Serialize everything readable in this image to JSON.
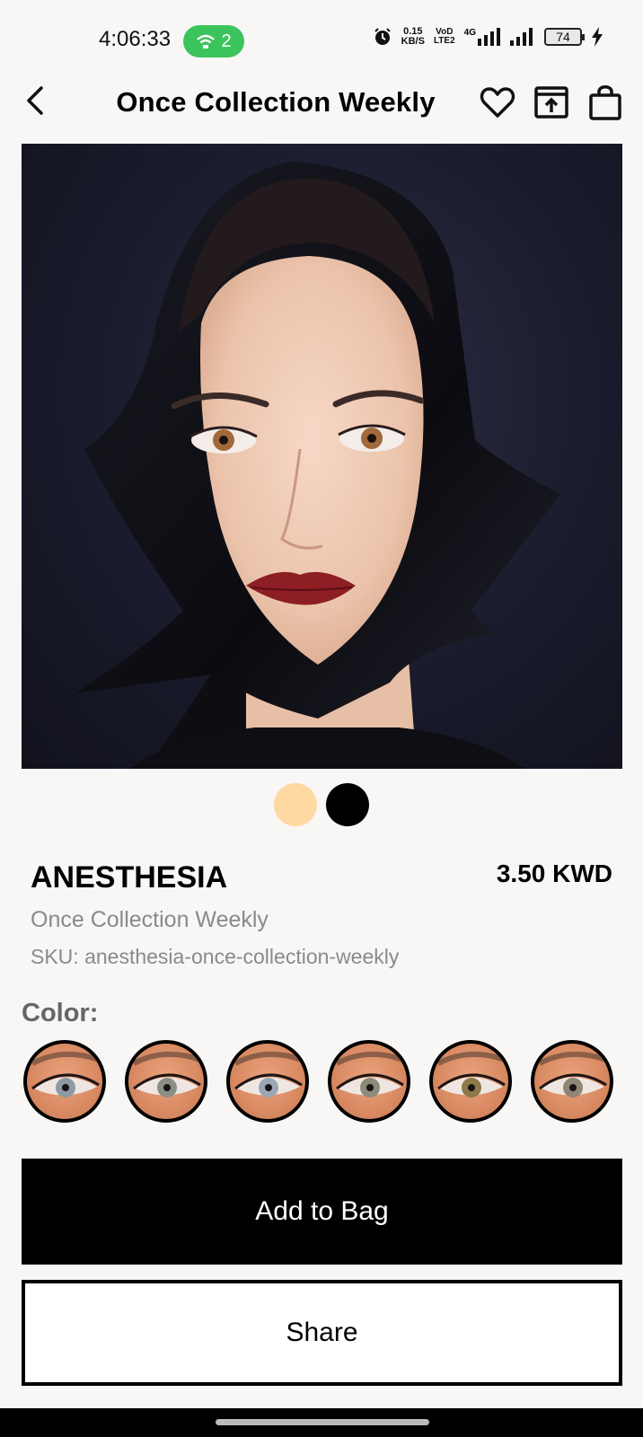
{
  "status_bar": {
    "time": "4:06:33",
    "hotspot_count": "2",
    "net_speed_value": "0.15",
    "net_speed_unit": "KB/S",
    "volte_top": "VoD",
    "volte_bottom": "LTE2",
    "network": "4G",
    "battery": "74"
  },
  "header": {
    "title": "Once Collection Weekly"
  },
  "gallery": {
    "dot_colors": [
      "#ffd9a3",
      "#000000"
    ]
  },
  "product": {
    "name": "ANESTHESIA",
    "price": "3.50 KWD",
    "collection": "Once Collection Weekly",
    "sku": "SKU: anesthesia-once-collection-weekly"
  },
  "color_section": {
    "label": "Color:",
    "swatch_count": 6,
    "iris_colors": [
      "#8d99a6",
      "#8a8f86",
      "#9aa6b2",
      "#8c8a7a",
      "#8d7a4a",
      "#8f8576"
    ]
  },
  "actions": {
    "add_to_bag": "Add to Bag",
    "share": "Share"
  },
  "colors": {
    "background": "#f8f7f5",
    "primary_button": "#000000",
    "muted_text": "#8a8a8a",
    "hotspot_pill": "#3cc45c"
  }
}
